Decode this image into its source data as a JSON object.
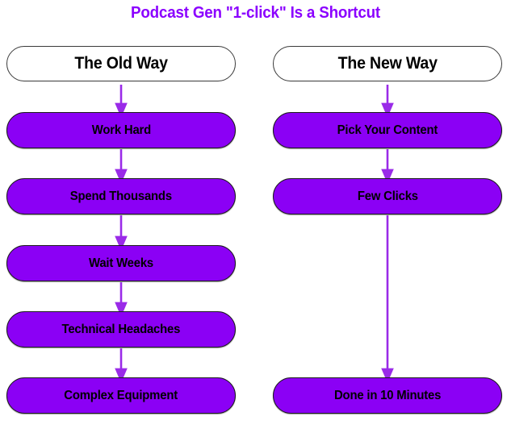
{
  "page": {
    "title": "Podcast Gen \"1-click\" Is a Shortcut",
    "background_color": "#ffffff",
    "title_color": "#8B00FF",
    "node_fill_color": "#8B00F5",
    "node_text_color": "#000000",
    "arrow_color": "#9A2BE8",
    "header_fill_color": "#ffffff",
    "header_border_color": "#3a3a3a"
  },
  "columns": [
    {
      "id": "old-way",
      "header": "The Old Way",
      "steps": [
        {
          "label": "Work Hard"
        },
        {
          "label": "Spend Thousands"
        },
        {
          "label": "Wait Weeks"
        },
        {
          "label": "Technical Headaches"
        },
        {
          "label": "Complex Equipment"
        }
      ]
    },
    {
      "id": "new-way",
      "header": "The New Way",
      "steps": [
        {
          "label": "Pick Your Content"
        },
        {
          "label": "Few Clicks"
        },
        {
          "label": "Done in 10 Minutes"
        }
      ]
    }
  ]
}
